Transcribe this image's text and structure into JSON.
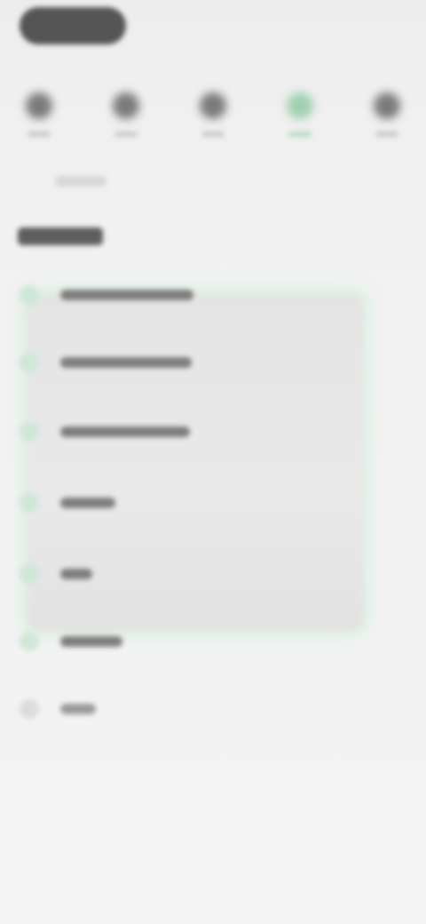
{
  "status_bar": {
    "pill_text": ""
  },
  "nav": {
    "items": [
      {
        "label": "",
        "icon": "circle-icon",
        "active": false
      },
      {
        "label": "",
        "icon": "circle-icon",
        "active": false
      },
      {
        "label": "",
        "icon": "circle-icon",
        "active": false
      },
      {
        "label": "",
        "icon": "circle-icon",
        "active": true
      },
      {
        "label": "",
        "icon": "circle-icon",
        "active": false
      }
    ],
    "active_color": "#9fd0b0"
  },
  "section": {
    "sub_label": "",
    "title": ""
  },
  "menu": {
    "items": [
      {
        "label": "",
        "icon": "bullet-icon"
      },
      {
        "label": "",
        "icon": "bullet-icon"
      },
      {
        "label": "",
        "icon": "bullet-icon"
      },
      {
        "label": "",
        "icon": "bullet-icon"
      },
      {
        "label": "",
        "icon": "bullet-icon"
      },
      {
        "label": "",
        "icon": "bullet-icon"
      },
      {
        "label": "",
        "icon": "bullet-icon"
      }
    ]
  }
}
